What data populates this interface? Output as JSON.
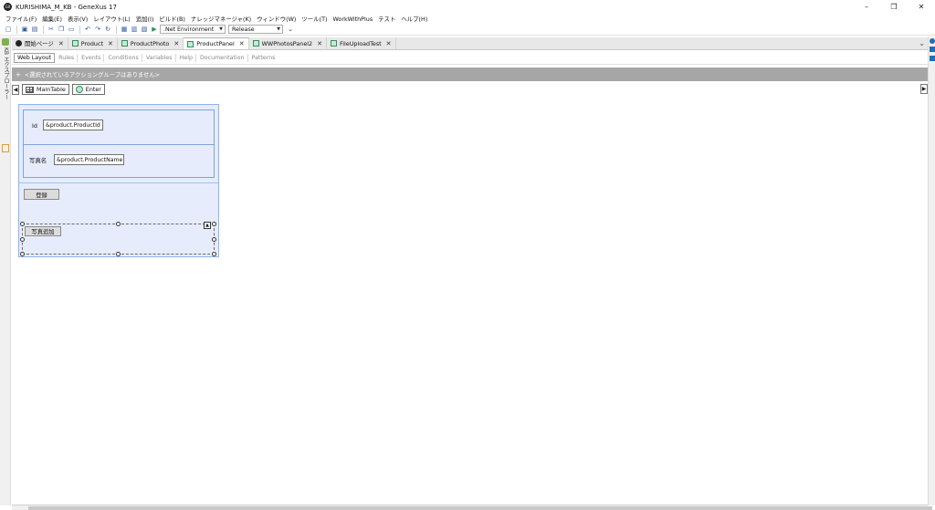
{
  "window": {
    "title": "KURISHIMA_M_KB - GeneXus 17",
    "app_icon_text": "GX",
    "controls": {
      "minimize": "–",
      "restore": "❐",
      "close": "✕"
    }
  },
  "menu": [
    "ファイル(F)",
    "編集(E)",
    "表示(V)",
    "レイアウト(L)",
    "追加(I)",
    "ビルド(B)",
    "ナレッジマネージャ(K)",
    "ウィンドウ(W)",
    "ツール(T)",
    "WorkWithPlus",
    "テスト",
    "ヘルプ(H)"
  ],
  "toolbar": {
    "environment": ".Net Environment",
    "configuration": "Release",
    "overflow": "⌄"
  },
  "left_panel": {
    "label": "KB エクスプローラー"
  },
  "tabs": [
    {
      "label": "開始ページ",
      "icon": "genexus-icon",
      "active": false
    },
    {
      "label": "Product",
      "icon": "transaction-icon",
      "active": false
    },
    {
      "label": "ProductPhoto",
      "icon": "transaction-icon",
      "active": false
    },
    {
      "label": "ProductPanel",
      "icon": "panel-icon",
      "active": true
    },
    {
      "label": "WWPhotosPanel2",
      "icon": "panel-icon",
      "active": false
    },
    {
      "label": "FileUploadTest",
      "icon": "panel-icon",
      "active": false
    }
  ],
  "subtabs": [
    {
      "label": "Web Layout",
      "active": true
    },
    {
      "label": "Rules",
      "active": false
    },
    {
      "label": "Events",
      "active": false
    },
    {
      "label": "Conditions",
      "active": false
    },
    {
      "label": "Variables",
      "active": false
    },
    {
      "label": "Help",
      "active": false
    },
    {
      "label": "Documentation",
      "active": false
    },
    {
      "label": "Patterns",
      "active": false
    }
  ],
  "action_bar": {
    "text": "<選択されているアクショングループはありません>"
  },
  "breadcrumb": {
    "main_table": "MainTable",
    "enter": "Enter"
  },
  "design": {
    "id_label": "Id",
    "id_field": "&product.ProductId",
    "name_label": "写真名",
    "name_field": "&product.ProductName",
    "register_button": "登録",
    "add_photo_button": "写真追加"
  }
}
